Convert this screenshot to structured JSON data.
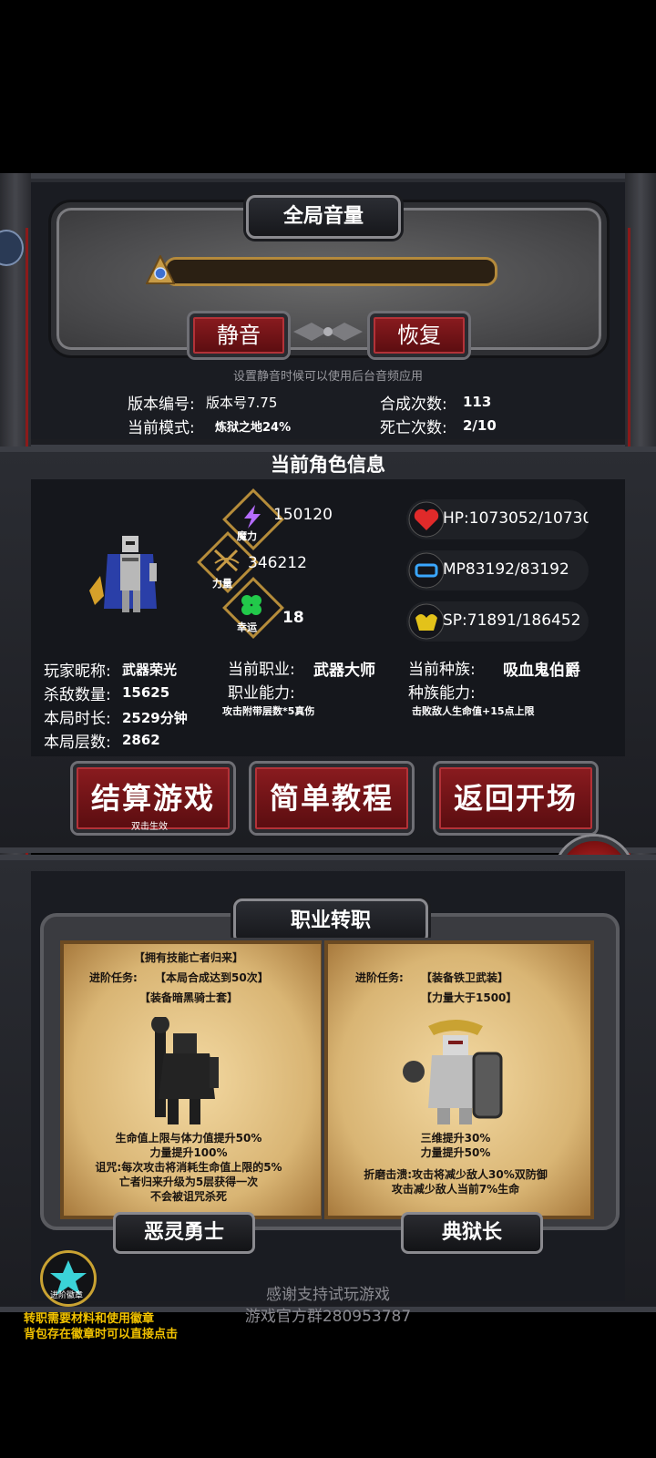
{
  "volume": {
    "title": "全局音量",
    "level": 0.0,
    "mute_label": "静音",
    "restore_label": "恢复",
    "hint": "设置静音时候可以使用后台音频应用"
  },
  "info": {
    "version_label": "版本编号:",
    "version_value": "版本号7.75",
    "mode_label": "当前模式:",
    "mode_value": "炼狱之地24%",
    "synth_label": "合成次数:",
    "synth_value": "113",
    "death_label": "死亡次数:",
    "death_value": "2/10"
  },
  "character": {
    "section_title": "当前角色信息",
    "magic_value": "150120",
    "magic_caption": "魔力",
    "power_value": "346212",
    "power_caption": "力量",
    "luck_value": "18",
    "luck_caption": "幸运",
    "hp": "HP:1073052/10730",
    "mp": "MP83192/83192",
    "sp": "SP:71891/186452",
    "nickname_label": "玩家昵称:",
    "nickname_value": "武器荣光",
    "kills_label": "杀敌数量:",
    "kills_value": "15625",
    "time_label": "本局时长:",
    "time_value": "2529分钟",
    "floor_label": "本局层数:",
    "floor_value": "2862",
    "job_label": "当前职业:",
    "job_value": "武器大师",
    "job_ability_label": "职业能力:",
    "job_ability_value": "攻击附带层数*5真伤",
    "race_label": "当前种族:",
    "race_value": "吸血鬼伯爵",
    "race_ability_label": "种族能力:",
    "race_ability_value": "击败敌人生命值+15点上限"
  },
  "buttons": {
    "settle_label": "结算游戏",
    "settle_hint": "双击生效",
    "tutorial_label": "简单教程",
    "back_label": "返回开场"
  },
  "job_change": {
    "title": "职业转职",
    "left": {
      "req1": "【拥有技能亡者归来】",
      "task_label": "进阶任务:",
      "req2": "【本局合成达到50次】",
      "req3": "【装备暗黑骑士套】",
      "desc1": "生命值上限与体力值提升50%",
      "desc2": "力量提升100%",
      "desc3": "诅咒:每次攻击将消耗生命值上限的5%",
      "desc4": "亡者归来升级为5层获得一次",
      "desc5": "不会被诅咒杀死",
      "name": "恶灵勇士"
    },
    "right": {
      "task_label": "进阶任务:",
      "req1": "【装备铁卫武装】",
      "req2": "【力量大于1500】",
      "desc1": "三维提升30%",
      "desc2": "力量提升50%",
      "desc3": "折磨击溃:攻击将减少敌人30%双防御",
      "desc4": "攻击减少敌人当前7%生命",
      "name": "典狱长"
    },
    "badge_caption": "进阶徽章",
    "note1": "转职需要材料和使用徽章",
    "note2": "背包存在徽章时可以直接点击"
  },
  "footer": {
    "thanks": "感谢支持试玩游戏",
    "group": "游戏官方群280953787"
  }
}
